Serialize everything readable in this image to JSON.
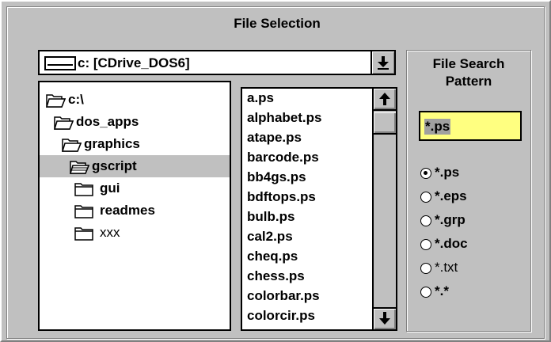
{
  "dialog": {
    "title": "File Selection"
  },
  "drive": {
    "value": "c: [CDrive_DOS6]",
    "icon": "drive-icon",
    "arrow_icon": "combo-down-arrow-icon"
  },
  "tree": {
    "items": [
      {
        "label": "c:\\",
        "state": "open",
        "selected": false
      },
      {
        "label": "dos_apps",
        "state": "open",
        "selected": false
      },
      {
        "label": "graphics",
        "state": "open",
        "selected": false
      },
      {
        "label": "gscript",
        "state": "open",
        "selected": true
      },
      {
        "label": "gui",
        "state": "closed",
        "selected": false
      },
      {
        "label": "readmes",
        "state": "closed",
        "selected": false
      },
      {
        "label": "xxx",
        "state": "closed",
        "selected": false
      }
    ]
  },
  "files": {
    "items": [
      "a.ps",
      "alphabet.ps",
      "atape.ps",
      "barcode.ps",
      "bb4gs.ps",
      "bdftops.ps",
      "bulb.ps",
      "cal2.ps",
      "cheq.ps",
      "chess.ps",
      "colorbar.ps",
      "colorcir.ps"
    ],
    "scroll_up_icon": "scroll-up-arrow-icon",
    "scroll_down_icon": "scroll-down-arrow-icon"
  },
  "pattern": {
    "title": "File Search Pattern",
    "title_lines": [
      "File Search",
      "Pattern"
    ],
    "value": "*.ps",
    "input_bg": "#ffff80",
    "options": [
      {
        "label": "*.ps",
        "checked": true
      },
      {
        "label": "*.eps",
        "checked": false
      },
      {
        "label": "*.grp",
        "checked": false
      },
      {
        "label": "*.doc",
        "checked": false
      },
      {
        "label": "*.txt",
        "checked": false
      },
      {
        "label": "*.*",
        "checked": false
      }
    ]
  }
}
